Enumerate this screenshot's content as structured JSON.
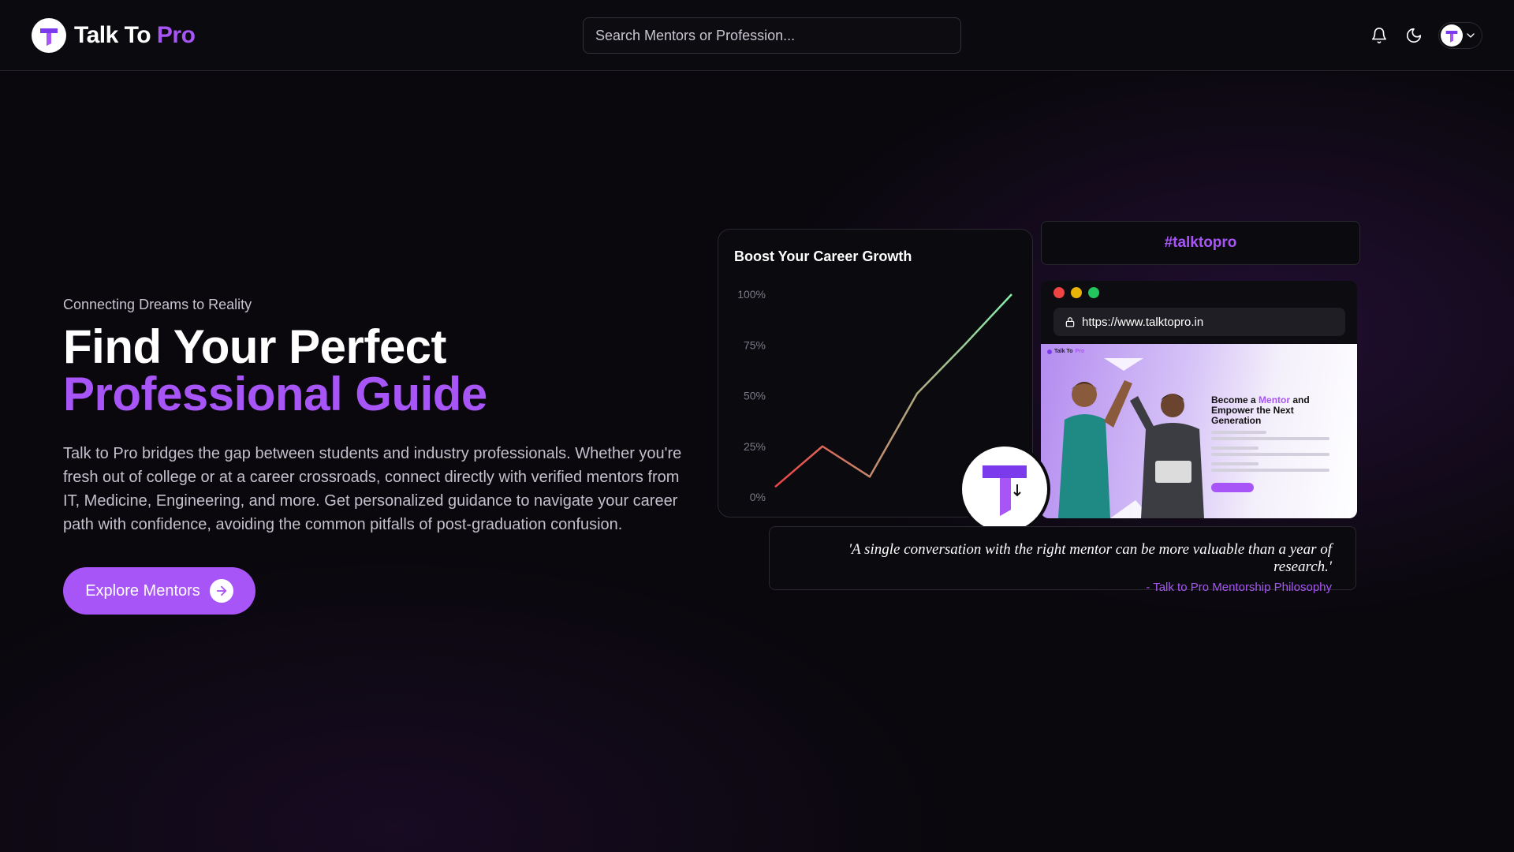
{
  "colors": {
    "accent": "#a855f7",
    "background": "#0a080d",
    "card": "#0b0a0e",
    "border": "#2a2830"
  },
  "header": {
    "brand_name": "Talk To ",
    "brand_accent": "Pro",
    "search_placeholder": "Search Mentors or Profession...",
    "icons": [
      "bell-icon",
      "moon-icon",
      "avatar",
      "chevron-down-icon"
    ]
  },
  "hero": {
    "tagline": "Connecting Dreams to Reality",
    "headline_line1": "Find Your Perfect",
    "headline_line2": "Professional Guide",
    "description": "Talk to Pro bridges the gap between students and industry professionals. Whether you're fresh out of college or at a career crossroads, connect directly with verified mentors from IT, Medicine, Engineering, and more. Get personalized guidance to navigate your career path with confidence, avoiding the common pitfalls of post-graduation confusion.",
    "cta_label": "Explore Mentors"
  },
  "chart_data": {
    "type": "line",
    "title": "Boost Your Career Growth",
    "x": [
      0,
      1,
      2,
      3,
      4,
      5
    ],
    "values": [
      5,
      25,
      10,
      51,
      75,
      100
    ],
    "yticks": [
      "100%",
      "75%",
      "50%",
      "25%",
      "0%"
    ],
    "ylim": [
      0,
      100
    ],
    "grid": false,
    "line_gradient": [
      "#ef4444",
      "#86efac"
    ]
  },
  "hashtag": "#talktopro",
  "browser": {
    "url": "https://www.talktopro.in",
    "dot_colors": [
      "#ef4444",
      "#eab308",
      "#22c55e"
    ],
    "preview": {
      "nav_brand": "Talk To ",
      "nav_brand_accent": "Pro",
      "heading_pre": "Become a ",
      "heading_accent": "Mentor",
      "heading_post": " and Empower the Next Generation"
    }
  },
  "quote": {
    "text": "'A single conversation with the right mentor can be more valuable than a year of research.'",
    "attribution": "- Talk to Pro Mentorship Philosophy"
  }
}
